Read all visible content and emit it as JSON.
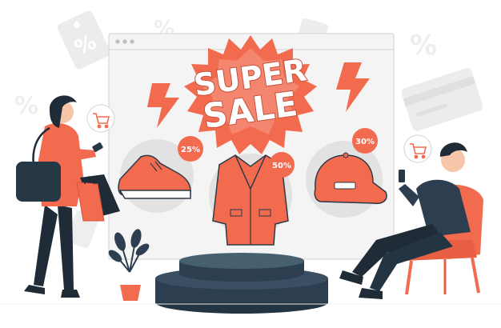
{
  "colors": {
    "accent": "#f26b4f",
    "accent_dark": "#d9553a",
    "navy": "#263746",
    "window_bg": "#f3f3f3",
    "window_border": "#dcdcdc",
    "faint": "#eeeeee"
  },
  "banner": {
    "line1": "SUPER",
    "line2": "SALE"
  },
  "badges": {
    "shoe": "25%",
    "coat": "50%",
    "cap": "30%"
  },
  "background_marks": {
    "percent": "%"
  },
  "icons": [
    "cart-icon",
    "lightning-icon",
    "percent-tag-icon",
    "credit-card-icon",
    "smartphone-icon"
  ]
}
